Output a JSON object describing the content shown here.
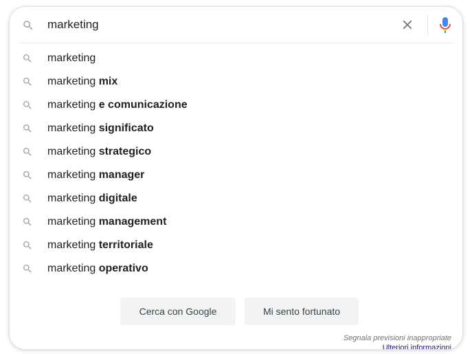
{
  "search": {
    "query": "marketing",
    "icon": "search-icon",
    "clear_icon": "close-icon",
    "mic_icon": "microphone-icon"
  },
  "suggestions": [
    {
      "prefix": "marketing",
      "completion": ""
    },
    {
      "prefix": "marketing",
      "completion": "mix"
    },
    {
      "prefix": "marketing",
      "completion": "e comunicazione"
    },
    {
      "prefix": "marketing",
      "completion": "significato"
    },
    {
      "prefix": "marketing",
      "completion": "strategico"
    },
    {
      "prefix": "marketing",
      "completion": "manager"
    },
    {
      "prefix": "marketing",
      "completion": "digitale"
    },
    {
      "prefix": "marketing",
      "completion": "management"
    },
    {
      "prefix": "marketing",
      "completion": "territoriale"
    },
    {
      "prefix": "marketing",
      "completion": "operativo"
    }
  ],
  "buttons": {
    "search_label": "Cerca con Google",
    "lucky_label": "Mi sento fortunato"
  },
  "footer": {
    "report_label": "Segnala previsioni inappropriate",
    "more_info_label": "Ulteriori informazioni"
  },
  "colors": {
    "text": "#202124",
    "icon": "#9aa0a6",
    "button_bg": "#f1f3f4",
    "link": "#1a0dab",
    "mic_blue": "#4285f4",
    "mic_red": "#ea4335",
    "mic_yellow": "#fbbc04",
    "mic_green": "#34a853"
  }
}
